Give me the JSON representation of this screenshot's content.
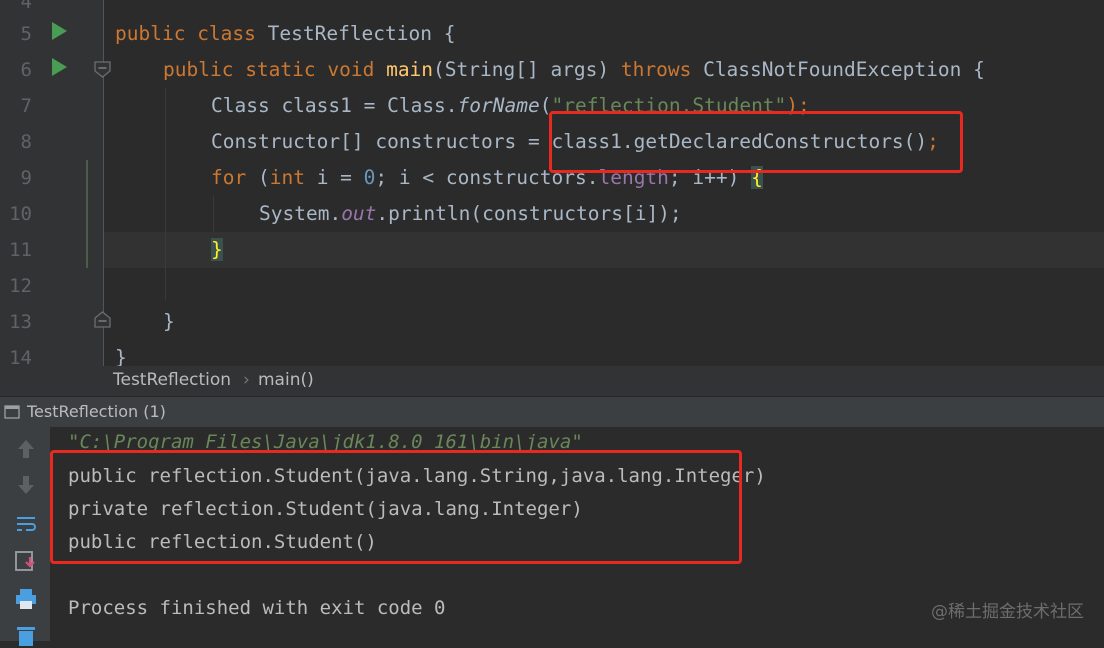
{
  "editor": {
    "line_numbers": [
      "4",
      "5",
      "6",
      "7",
      "8",
      "9",
      "10",
      "11",
      "12",
      "13",
      "14"
    ],
    "lines": {
      "l5": {
        "kw1": "public ",
        "kw2": "class ",
        "name": "TestReflection",
        "rest": " {"
      },
      "l6": {
        "kw1": "public ",
        "kw2": "static ",
        "kw3": "void ",
        "method": "main",
        "params": "(String[] args) ",
        "throws": "throws ",
        "exc": "ClassNotFoundException {"
      },
      "l7": {
        "pre": "Class class1 = Class.",
        "call": "forName",
        "open": "(",
        "str": "\"reflection.Student\"",
        "close": ");"
      },
      "l8": {
        "pre": "Constructor[] constructors = ",
        "expr": "class1.getDeclaredConstructors()",
        "semi": ";"
      },
      "l9": {
        "kw": "for ",
        "open": "(",
        "kw_int": "int ",
        "mid": "i = ",
        "zero": "0",
        "sep": "; i < constructors.",
        "field": "length",
        "rest": "; i++) ",
        "brace": "{"
      },
      "l10": {
        "pre": "System.",
        "out": "out",
        "rest": ".println(constructors[i]);"
      },
      "l11": {
        "brace": "}"
      },
      "l13": {
        "brace": "}"
      },
      "l14": {
        "brace": "}"
      }
    }
  },
  "breadcrumb": {
    "class": "TestReflection",
    "sep": "›",
    "method": "main()"
  },
  "run_panel": {
    "title": "TestReflection (1)"
  },
  "console": {
    "command": "\"C:\\Program Files\\Java\\jdk1.8.0_161\\bin\\java\"",
    "lines": [
      "public reflection.Student(java.lang.String,java.lang.Integer)",
      "private reflection.Student(java.lang.Integer)",
      "public reflection.Student()"
    ],
    "exit": "Process finished with exit code 0"
  },
  "watermark": "@稀土掘金技术社区",
  "colors": {
    "highlight_box": "#e8291f",
    "keyword": "#cc7832",
    "method": "#ffc66d",
    "string": "#6a8759"
  }
}
